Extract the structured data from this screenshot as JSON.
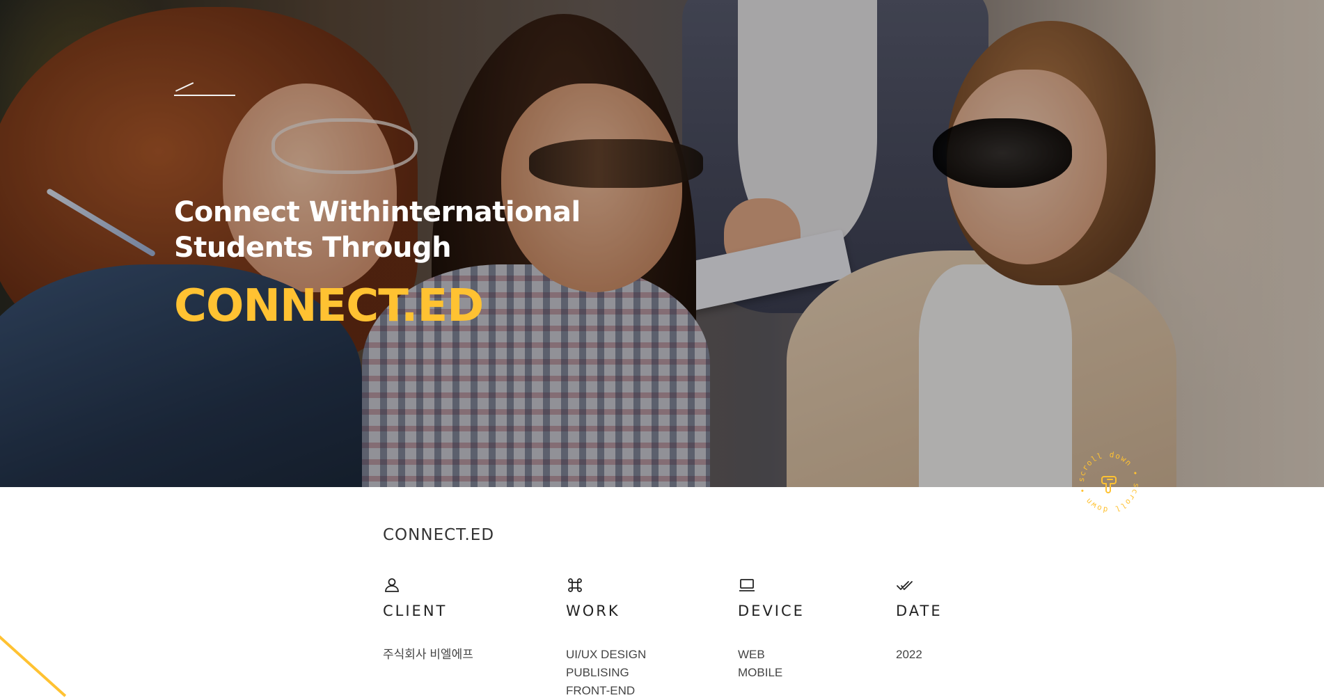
{
  "hero": {
    "subtitle_line1": "Connect Withinternational",
    "subtitle_line2": "Students Through",
    "title": "CONNECT.ED"
  },
  "scroll_badge": {
    "text": "scroll down • scroll down •",
    "icon": "pointing-hand-icon"
  },
  "project": {
    "name": "CONNECT.ED"
  },
  "info": {
    "client": {
      "icon": "user-icon",
      "heading": "CLIENT",
      "items": [
        "주식회사 비엘에프"
      ]
    },
    "work": {
      "icon": "command-icon",
      "heading": "WORK",
      "items": [
        "UI/UX DESIGN",
        "PUBLISING",
        "FRONT-END"
      ]
    },
    "device": {
      "icon": "laptop-icon",
      "heading": "DEVICE",
      "items": [
        "WEB",
        "MOBILE"
      ]
    },
    "date": {
      "icon": "double-check-icon",
      "heading": "DATE",
      "items": [
        "2022"
      ]
    }
  },
  "colors": {
    "accent": "#ffc232",
    "text": "#222222",
    "background": "#ffffff"
  }
}
